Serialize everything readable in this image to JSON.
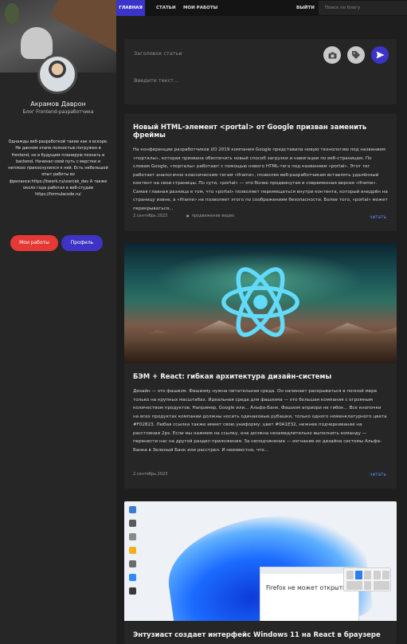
{
  "nav": {
    "main": "ГЛАВНАЯ",
    "articles": "СТАТЬИ",
    "works": "МОИ РАБОТЫ",
    "logout": "ВЫЙТИ",
    "search_placeholder": "Поиск по блогу"
  },
  "profile": {
    "name": "Акрамов Даврон",
    "subtitle": "Блог Frontend-разработчика",
    "bio": "Однажды веб-разработкой такие как я вскоре. Не данном этапе полностью погружен в frontend, но в будущем планирую познать и backend. Начинал свой путь с верстки и неплохо прикоснулился к ней. Есть небольшой опыт работы во фрилансе:https://kwork.ru/user/ak_dav А также около года работал в веб-студии https://formulacode.ru/",
    "btn_works": "Мои работы",
    "btn_profile": "Профиль"
  },
  "composer": {
    "title_placeholder": "Заголовок статьи",
    "text_placeholder": "Введите текст..."
  },
  "posts": [
    {
      "title": "Новый HTML-элемент <portal> от Google призван заменить фреймы",
      "text": "На конференции разработчиков I/O 2019 компания Google представила новую технологию под названием «порталы», которая призвана обеспечить новый способ загрузки и навигации по веб-страницам. По словам Google, «порталы» работают с помощью нового HTML-тега под названием «portal». Этот тег работает аналогично классическим тегам «iframe», позволяя веб-разработчикам вставлять удалённый контент на свои страницы. По сути, «portal» — это более продвинутая и современная версия «iframe». Самая главная разница в том, что «portal» позволяет перемещаться внутри контента, который внедрён на страницу извне, а «iframe» не позволяет этого по соображениям безопасности. Более того, «portal» может перекрываться...",
      "date": "2.сентябрь.2023",
      "extra": "продвижение видео",
      "read": "читать"
    },
    {
      "title": "БЭМ + React: гибкая архитектура дизайн-системы",
      "text": "Дизайн — это фашизм. Фашизму нужна питательная среда. Он начинает раскрываться в полной мере только на крупных масштабах. Идеальная среда для фашизма — это большая компания с огромным количеством продуктов. Например, Google или... Альфа-Банк. Фашизм априори не гибок... Все кнопочки на всех продуктах компании должны носить одинаковые рубашки, только одного номенклатурного цвета #F02823. Любая ссылка также имеет свою униформу: цвет #0A1E32, нижнее подчеркивание на расстоянии 2px. Если мы нажмем на ссылку, она должна незамедлительно выполнить команду — перенести нас на другой раздел приложения. За неподчинение — изгнание из дизайна системы Альфа-Банка в Зеленый Банк или расстрел. И неизвестно, что...",
      "date": "2.сентябрь.2023",
      "read": "читать"
    },
    {
      "title": "Энтузиаст создает интерфейс Windows 11 на React в браузере",
      "screen_text": "Firefox не может открыть страницу"
    }
  ],
  "icons": {
    "photo": "camera-icon",
    "tag": "tag-icon",
    "send": "send-icon"
  },
  "colors": {
    "accent": "#3b34c9",
    "danger": "#e53935",
    "link": "#5a8cff",
    "react": "#61dafb"
  }
}
